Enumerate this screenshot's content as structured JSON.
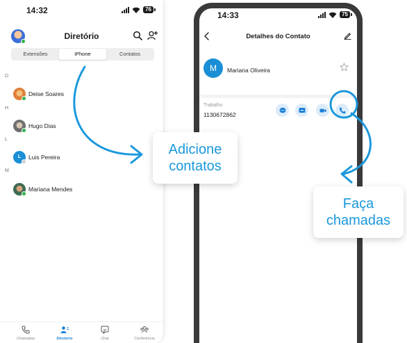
{
  "colors": {
    "accent": "#1a98dc",
    "online": "#2fb34a",
    "avatar_blue": "#1a8fd6"
  },
  "left_phone": {
    "status": {
      "time": "14:32",
      "battery": "76"
    },
    "header": {
      "title": "Diretório"
    },
    "segments": [
      {
        "label": "Extensões",
        "active": false
      },
      {
        "label": "iPhone",
        "active": true
      },
      {
        "label": "Contatos",
        "active": false
      }
    ],
    "sections": [
      {
        "letter": "D",
        "contact": "Deise Soares",
        "initial": ""
      },
      {
        "letter": "H",
        "contact": "Hugo Dias",
        "initial": ""
      },
      {
        "letter": "L",
        "contact": "Luis Pereira",
        "initial": "L"
      },
      {
        "letter": "M",
        "contact": "Mariana Mendes",
        "initial": ""
      }
    ],
    "tabs": [
      {
        "label": "Chamadas",
        "icon": "phone-icon",
        "active": false
      },
      {
        "label": "Diretório",
        "icon": "contacts-icon",
        "active": true
      },
      {
        "label": "Chat",
        "icon": "chat-icon",
        "active": false
      },
      {
        "label": "Conferência",
        "icon": "group-icon",
        "active": false
      }
    ]
  },
  "right_phone": {
    "status": {
      "time": "14:33",
      "battery": "75"
    },
    "header": {
      "title": "Detalhes do Contato"
    },
    "contact": {
      "initial": "M",
      "name": "Mariana Oliveira"
    },
    "phone_entry": {
      "label": "Trabalho",
      "number": "1130672862"
    },
    "actions": [
      "chat-bubble-icon",
      "message-icon",
      "video-icon",
      "phone-icon"
    ]
  },
  "callouts": {
    "add": {
      "line1": "Adicione",
      "line2": "contatos"
    },
    "call": {
      "line1": "Faça",
      "line2": "chamadas"
    }
  }
}
